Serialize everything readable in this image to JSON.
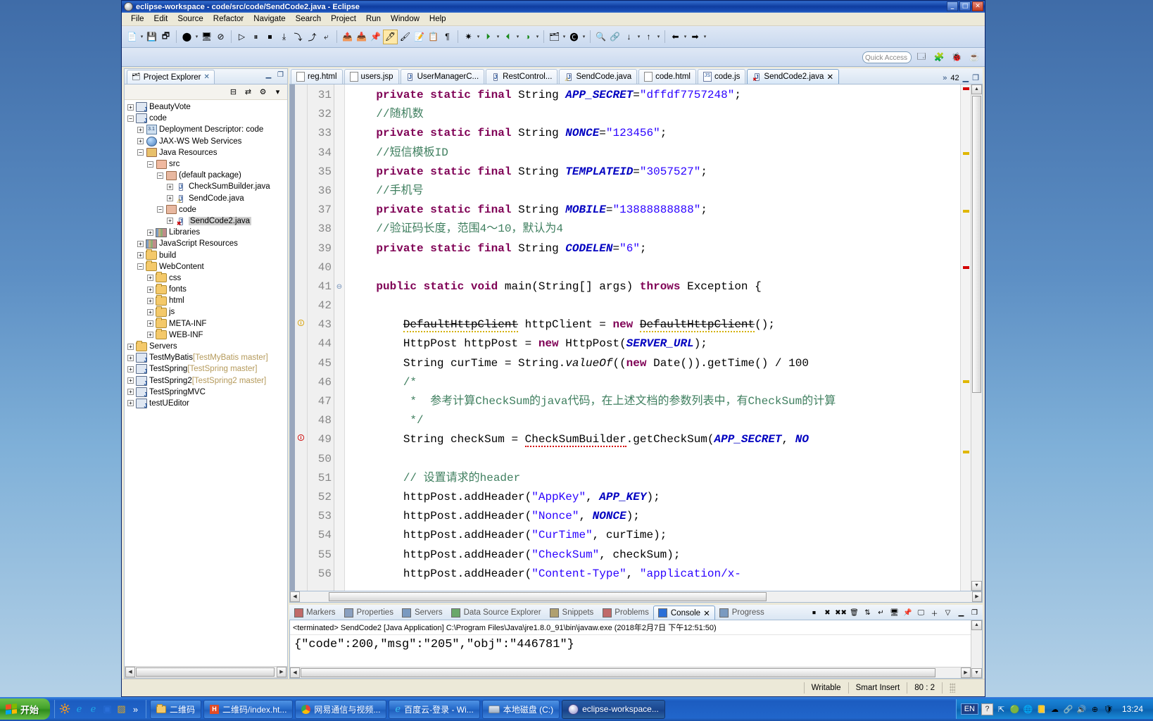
{
  "window": {
    "title": "eclipse-workspace - code/src/code/SendCode2.java - Eclipse",
    "icon": "eclipse-icon",
    "minimize": "_",
    "maximize": "□",
    "close": "✕"
  },
  "menubar": [
    "File",
    "Edit",
    "Source",
    "Refactor",
    "Navigate",
    "Search",
    "Project",
    "Run",
    "Window",
    "Help"
  ],
  "toolbar": {
    "quick_access_placeholder": "Quick Access",
    "groups": [
      [
        "new-wizard-icon",
        "▾",
        "save-icon",
        "save-all-icon",
        "debug-icon",
        "▾",
        "open-console-icon",
        "toggle-breadcrumb-icon"
      ],
      [
        "resume-icon",
        "suspend-icon",
        "terminate-icon",
        "step-into-icon",
        "step-over-icon",
        "step-return-icon",
        "drop-to-frame-icon"
      ],
      [
        "export-icon",
        "import-icon",
        "pin-console-icon",
        "highlight-icon",
        "annotate-icon",
        "run-last-tool-icon",
        "open-type-icon",
        "show-whitespace-icon"
      ],
      [
        "external-tools-icon",
        "▾",
        "run-icon",
        "▾",
        "debug-run-icon",
        "▾",
        "profile-icon",
        "▾"
      ],
      [
        "new-java-project-icon",
        "▾",
        "new-class-icon",
        "▾",
        "search-icon",
        "▾",
        "open-task-icon",
        "▾"
      ],
      [
        "next-annotation-icon",
        "▾",
        "prev-annotation-icon",
        "▾",
        "back-icon",
        "▾",
        "forward-icon",
        "▾"
      ]
    ],
    "perspective_buttons": [
      "open-perspective-icon",
      "java-ee-perspective-icon",
      "debug-perspective-icon",
      "java-perspective-icon"
    ]
  },
  "project_explorer": {
    "tab_label": "Project Explorer",
    "close_glyph": "✕",
    "minimize_glyph": "▁",
    "maximize_glyph": "❐",
    "local_toolbar": [
      "collapse-all-icon",
      "link-with-editor-icon",
      "view-menu-icon",
      "chevron-down-icon"
    ],
    "tree": [
      {
        "indent": 0,
        "exp": "+",
        "icon": "java-project-icon",
        "label": "BeautyVote",
        "sub": "",
        "selected": false
      },
      {
        "indent": 0,
        "exp": "−",
        "icon": "java-project-icon",
        "label": "code",
        "sub": "",
        "selected": false
      },
      {
        "indent": 1,
        "exp": "+",
        "icon": "deployment-descriptor-icon",
        "label": "Deployment Descriptor: code",
        "sub": "",
        "selected": false
      },
      {
        "indent": 1,
        "exp": "+",
        "icon": "web-services-icon",
        "label": "JAX-WS Web Services",
        "sub": "",
        "selected": false
      },
      {
        "indent": 1,
        "exp": "−",
        "icon": "java-resources-icon",
        "label": "Java Resources",
        "sub": "",
        "selected": false
      },
      {
        "indent": 2,
        "exp": "−",
        "icon": "source-folder-icon",
        "label": "src",
        "sub": "",
        "selected": false
      },
      {
        "indent": 3,
        "exp": "−",
        "icon": "package-icon",
        "label": "(default package)",
        "sub": "",
        "selected": false
      },
      {
        "indent": 4,
        "exp": "+",
        "icon": "java-file-icon",
        "label": "CheckSumBuilder.java",
        "sub": "",
        "selected": false
      },
      {
        "indent": 4,
        "exp": "+",
        "icon": "java-file-warning-icon",
        "label": "SendCode.java",
        "sub": "",
        "selected": false
      },
      {
        "indent": 3,
        "exp": "−",
        "icon": "package-icon",
        "label": "code",
        "sub": "",
        "selected": false
      },
      {
        "indent": 4,
        "exp": "+",
        "icon": "java-file-error-icon",
        "label": "SendCode2.java",
        "sub": "",
        "selected": true
      },
      {
        "indent": 2,
        "exp": "+",
        "icon": "library-icon",
        "label": "Libraries",
        "sub": "",
        "selected": false
      },
      {
        "indent": 1,
        "exp": "+",
        "icon": "library-icon",
        "label": "JavaScript Resources",
        "sub": "",
        "selected": false
      },
      {
        "indent": 1,
        "exp": "+",
        "icon": "folder-icon",
        "label": "build",
        "sub": "",
        "selected": false
      },
      {
        "indent": 1,
        "exp": "−",
        "icon": "folder-icon",
        "label": "WebContent",
        "sub": "",
        "selected": false
      },
      {
        "indent": 2,
        "exp": "+",
        "icon": "folder-icon",
        "label": "css",
        "sub": "",
        "selected": false
      },
      {
        "indent": 2,
        "exp": "+",
        "icon": "folder-icon",
        "label": "fonts",
        "sub": "",
        "selected": false
      },
      {
        "indent": 2,
        "exp": "+",
        "icon": "folder-icon",
        "label": "html",
        "sub": "",
        "selected": false
      },
      {
        "indent": 2,
        "exp": "+",
        "icon": "folder-icon",
        "label": "js",
        "sub": "",
        "selected": false
      },
      {
        "indent": 2,
        "exp": "+",
        "icon": "folder-icon",
        "label": "META-INF",
        "sub": "",
        "selected": false
      },
      {
        "indent": 2,
        "exp": "+",
        "icon": "folder-icon",
        "label": "WEB-INF",
        "sub": "",
        "selected": false
      },
      {
        "indent": 0,
        "exp": "+",
        "icon": "folder-icon",
        "label": "Servers",
        "sub": "",
        "selected": false
      },
      {
        "indent": 0,
        "exp": "+",
        "icon": "java-project-icon",
        "label": "TestMyBatis",
        "sub": "[TestMyBatis master]",
        "selected": false
      },
      {
        "indent": 0,
        "exp": "+",
        "icon": "java-project-icon",
        "label": "TestSpring",
        "sub": "[TestSpring master]",
        "selected": false
      },
      {
        "indent": 0,
        "exp": "+",
        "icon": "java-project-icon",
        "label": "TestSpring2",
        "sub": "[TestSpring2 master]",
        "selected": false
      },
      {
        "indent": 0,
        "exp": "+",
        "icon": "java-project-icon",
        "label": "TestSpringMVC",
        "sub": "",
        "selected": false
      },
      {
        "indent": 0,
        "exp": "+",
        "icon": "java-project-icon",
        "label": "testUEditor",
        "sub": "",
        "selected": false
      }
    ]
  },
  "editor": {
    "tabs": [
      {
        "label": "reg.html",
        "icon": "html-file-icon",
        "active": false,
        "close": ""
      },
      {
        "label": "users.jsp",
        "icon": "jsp-file-icon",
        "active": false,
        "close": ""
      },
      {
        "label": "UserManagerC...",
        "icon": "java-file-icon",
        "active": false,
        "close": ""
      },
      {
        "label": "RestControl...",
        "icon": "java-file-icon",
        "active": false,
        "close": ""
      },
      {
        "label": "SendCode.java",
        "icon": "java-file-warning-icon",
        "active": false,
        "close": ""
      },
      {
        "label": "code.html",
        "icon": "html-file-icon",
        "active": false,
        "close": ""
      },
      {
        "label": "code.js",
        "icon": "js-file-icon",
        "active": false,
        "close": ""
      },
      {
        "label": "SendCode2.java",
        "icon": "java-file-error-icon",
        "active": true,
        "close": "✕"
      }
    ],
    "overflow_label": "42",
    "overflow_chevron": "»",
    "minimize_glyph": "▁",
    "maximize_glyph": "❐",
    "lines": [
      {
        "n": "31",
        "marker": "",
        "fold": "",
        "html": "    <span class='kw'>private</span> <span class='kw'>static</span> <span class='kw'>final</span> String <span class='fld'>APP_SECRET</span>=<span class='str'>\"dffdf7757248\"</span>;"
      },
      {
        "n": "32",
        "marker": "",
        "fold": "",
        "html": "    <span class='cmt'>//随机数</span>"
      },
      {
        "n": "33",
        "marker": "",
        "fold": "",
        "html": "    <span class='kw'>private</span> <span class='kw'>static</span> <span class='kw'>final</span> String <span class='fld'>NONCE</span>=<span class='str'>\"123456\"</span>;"
      },
      {
        "n": "34",
        "marker": "",
        "fold": "",
        "html": "    <span class='cmt'>//短信模板ID</span>"
      },
      {
        "n": "35",
        "marker": "",
        "fold": "",
        "html": "    <span class='kw'>private</span> <span class='kw'>static</span> <span class='kw'>final</span> String <span class='fld'>TEMPLATEID</span>=<span class='str'>\"3057527\"</span>;"
      },
      {
        "n": "36",
        "marker": "",
        "fold": "",
        "html": "    <span class='cmt'>//手机号</span>"
      },
      {
        "n": "37",
        "marker": "",
        "fold": "",
        "html": "    <span class='kw'>private</span> <span class='kw'>static</span> <span class='kw'>final</span> String <span class='fld'>MOBILE</span>=<span class='str'>\"13888888888\"</span>;"
      },
      {
        "n": "38",
        "marker": "",
        "fold": "",
        "html": "    <span class='cmt'>//验证码长度，范围4～10，默认为4</span>"
      },
      {
        "n": "39",
        "marker": "",
        "fold": "",
        "html": "    <span class='kw'>private</span> <span class='kw'>static</span> <span class='kw'>final</span> String <span class='fld'>CODELEN</span>=<span class='str'>\"6\"</span>;"
      },
      {
        "n": "40",
        "marker": "",
        "fold": "",
        "html": ""
      },
      {
        "n": "41",
        "marker": "",
        "fold": "⊖",
        "html": "    <span class='kw'>public</span> <span class='kw'>static</span> <span class='kw'>void</span> main(String[] args) <span class='kw'>throws</span> Exception {"
      },
      {
        "n": "42",
        "marker": "",
        "fold": "",
        "html": ""
      },
      {
        "n": "43",
        "marker": "warning",
        "fold": "",
        "html": "        <span class='dep warnsq'>DefaultHttpClient</span> httpClient = <span class='kw'>new</span> <span class='dep warnsq'>DefaultHttpClient</span>();"
      },
      {
        "n": "44",
        "marker": "",
        "fold": "",
        "html": "        HttpPost httpPost = <span class='kw'>new</span> HttpPost(<span class='fld'>SERVER_URL</span>);"
      },
      {
        "n": "45",
        "marker": "",
        "fold": "",
        "html": "        String curTime = String.<span class='stat'>valueOf</span>((<span class='kw'>new</span> Date()).getTime() / 100"
      },
      {
        "n": "46",
        "marker": "",
        "fold": "",
        "html": "        <span class='cmt'>/*</span>"
      },
      {
        "n": "47",
        "marker": "",
        "fold": "",
        "html": "         <span class='cmt'>*  参考计算CheckSum的java代码，在上述文档的参数列表中，有CheckSum的计算</span>"
      },
      {
        "n": "48",
        "marker": "",
        "fold": "",
        "html": "         <span class='cmt'>*/</span>"
      },
      {
        "n": "49",
        "marker": "error",
        "fold": "",
        "html": "        String checkSum = <span class='errsq'>CheckSumBuilder</span>.getCheckSum(<span class='fld'>APP_SECRET</span>, <span class='fld'>NO</span>"
      },
      {
        "n": "50",
        "marker": "",
        "fold": "",
        "html": ""
      },
      {
        "n": "51",
        "marker": "",
        "fold": "",
        "html": "        <span class='cmt'>// 设置请求的header</span>"
      },
      {
        "n": "52",
        "marker": "",
        "fold": "",
        "html": "        httpPost.addHeader(<span class='str'>\"AppKey\"</span>, <span class='fld'>APP_KEY</span>);"
      },
      {
        "n": "53",
        "marker": "",
        "fold": "",
        "html": "        httpPost.addHeader(<span class='str'>\"Nonce\"</span>, <span class='fld'>NONCE</span>);"
      },
      {
        "n": "54",
        "marker": "",
        "fold": "",
        "html": "        httpPost.addHeader(<span class='str'>\"CurTime\"</span>, curTime);"
      },
      {
        "n": "55",
        "marker": "",
        "fold": "",
        "html": "        httpPost.addHeader(<span class='str'>\"CheckSum\"</span>, checkSum);"
      },
      {
        "n": "56",
        "marker": "",
        "fold": "",
        "html": "        httpPost.addHeader(<span class='str'>\"Content-Type\"</span>, <span class='str'>\"application/x-</span>"
      }
    ]
  },
  "console": {
    "tabs": [
      {
        "label": "Markers",
        "icon": "markers-icon",
        "active": false
      },
      {
        "label": "Properties",
        "icon": "properties-icon",
        "active": false
      },
      {
        "label": "Servers",
        "icon": "servers-icon",
        "active": false
      },
      {
        "label": "Data Source Explorer",
        "icon": "data-source-explorer-icon",
        "active": false
      },
      {
        "label": "Snippets",
        "icon": "snippets-icon",
        "active": false
      },
      {
        "label": "Problems",
        "icon": "problems-icon",
        "active": false
      },
      {
        "label": "Console",
        "icon": "console-icon",
        "active": true,
        "close": "✕"
      },
      {
        "label": "Progress",
        "icon": "progress-icon",
        "active": false
      }
    ],
    "toolbar": [
      "terminate-icon",
      "remove-launch-icon",
      "remove-all-terminated-icon",
      "clear-console-icon",
      "scroll-lock-icon",
      "word-wrap-icon",
      "show-console-icon",
      "pin-console-icon",
      "display-selected-console-icon",
      "open-console-icon",
      "view-menu-icon",
      "minimize-icon",
      "maximize-icon"
    ],
    "header": "<terminated> SendCode2 [Java Application] C:\\Program Files\\Java\\jre1.8.0_91\\bin\\javaw.exe (2018年2月7日 下午12:51:50)",
    "output": "{\"code\":200,\"msg\":\"205\",\"obj\":\"446781\"}"
  },
  "statusbar": {
    "writable": "Writable",
    "insert_mode": "Smart Insert",
    "position": "80 : 2"
  },
  "taskbar": {
    "start_label": "开始",
    "quick_launch": [
      "show-desktop-icon",
      "ie-browser-icon",
      "media-player-icon"
    ],
    "quick_launch_more": "»",
    "tasks": [
      {
        "label": "二维码",
        "icon": "folder-icon",
        "active": false
      },
      {
        "label": "二维码/index.ht...",
        "icon": "html-doc-icon",
        "active": false
      },
      {
        "label": "网易通信与视频...",
        "icon": "chrome-icon",
        "active": false
      },
      {
        "label": "百度云-登录 - Wi...",
        "icon": "ie-browser-icon",
        "active": false
      },
      {
        "label": "本地磁盘 (C:)",
        "icon": "disk-drive-icon",
        "active": false
      },
      {
        "label": "eclipse-workspace...",
        "icon": "eclipse-icon",
        "active": true
      }
    ],
    "lang_indicator": "EN",
    "help_indicator": "?",
    "tray_icons": [
      "tray-expand-icon",
      "antivirus-icon",
      "network-icon",
      "notes-icon",
      "cloud-icon",
      "sharing-icon",
      "volume-icon",
      "update-icon",
      "shield-icon"
    ],
    "clock": "13:24"
  }
}
